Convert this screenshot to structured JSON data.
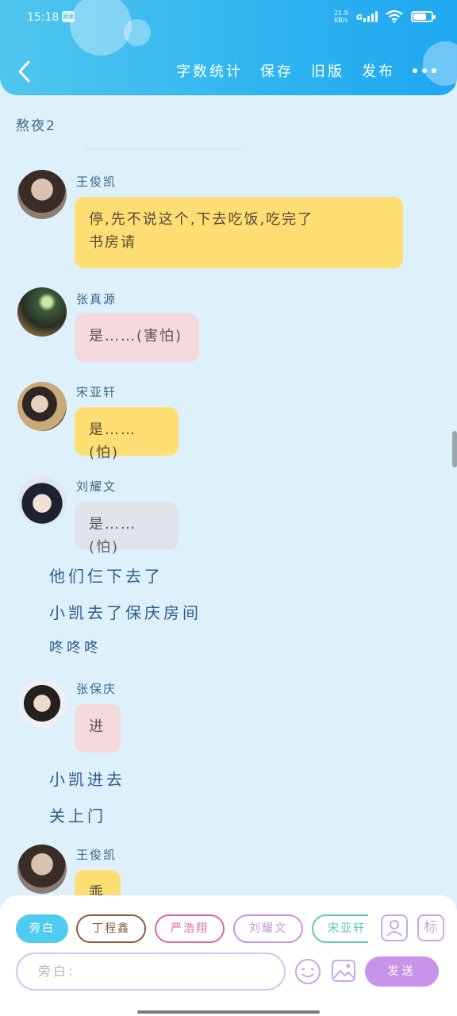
{
  "status_bar": {
    "time": "15:18",
    "badge": "阅读",
    "net_speed_top": "21.9",
    "net_speed_bottom": "KB/s",
    "network": "G"
  },
  "header": {
    "actions": [
      "字数统计",
      "保存",
      "旧版",
      "发布"
    ]
  },
  "chat": {
    "title": "熬夜2",
    "messages": [
      {
        "type": "bubble",
        "name": "王俊凯",
        "text_line1": "停,先不说这个,下去吃饭,吃完了",
        "text_line2": "书房请",
        "color": "#fdde72"
      },
      {
        "type": "bubble",
        "name": "张真源",
        "text": "是……(害怕)",
        "color": "#f4dadc"
      },
      {
        "type": "bubble",
        "name": "宋亚轩",
        "text": "是……(怕)",
        "color": "#fdde72"
      },
      {
        "type": "bubble",
        "name": "刘耀文",
        "text": "是……(怕)",
        "color": "#e0e4ea"
      },
      {
        "type": "narration",
        "text": "他们仨下去了"
      },
      {
        "type": "narration",
        "text": "小凯去了保庆房间"
      },
      {
        "type": "narration",
        "text": "咚咚咚"
      },
      {
        "type": "bubble",
        "name": "张保庆",
        "text": "进",
        "color": "#f4dadc"
      },
      {
        "type": "narration",
        "text": "小凯进去"
      },
      {
        "type": "narration",
        "text": "关上门"
      },
      {
        "type": "bubble",
        "name": "王俊凯",
        "text": "乖",
        "color": "#fdde72"
      }
    ]
  },
  "composer": {
    "roles": [
      {
        "label": "旁白",
        "color": "#4fcaf0",
        "active": true
      },
      {
        "label": "丁程鑫",
        "color": "#8a5a3c",
        "active": false
      },
      {
        "label": "严浩翔",
        "color": "#d66aa4",
        "active": false
      },
      {
        "label": "刘耀文",
        "color": "#c793e4",
        "active": false
      },
      {
        "label": "宋亚轩",
        "color": "#5ec9b8",
        "active": false
      }
    ],
    "placeholder": "旁白:",
    "send_label": "发送",
    "mark_label": "标"
  }
}
